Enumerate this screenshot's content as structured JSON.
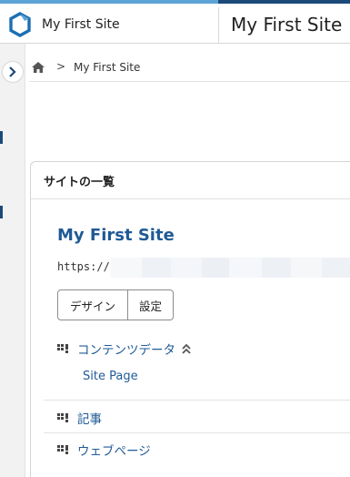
{
  "header": {
    "site_name": "My First Site",
    "page_title": "My First Site"
  },
  "breadcrumb": {
    "separator": ">",
    "current": "My First Site"
  },
  "panel": {
    "title": "サイトの一覧",
    "site": {
      "name": "My First Site",
      "url_prefix": "https://",
      "buttons": {
        "design": "デザイン",
        "settings": "設定"
      }
    },
    "tree": {
      "content_data": "コンテンツデータ",
      "site_page": "Site Page",
      "articles": "記事",
      "web_pages": "ウェブページ"
    }
  },
  "colors": {
    "accent": "#1b4a7a",
    "link": "#1f5a96"
  }
}
